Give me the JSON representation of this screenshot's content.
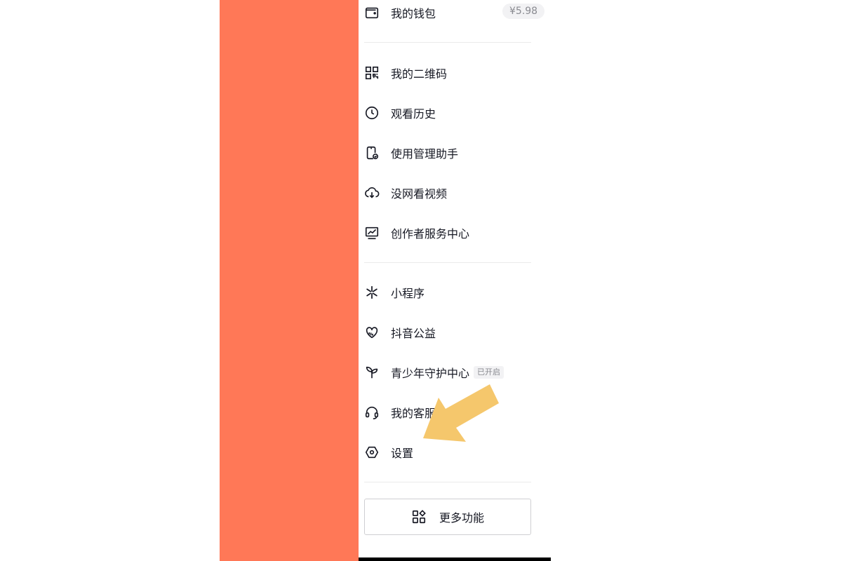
{
  "drawer": {
    "wallet": {
      "label": "我的钱包",
      "badge": "¥5.98",
      "icon": "wallet-icon"
    },
    "group1": [
      {
        "label": "我的二维码",
        "icon": "qr-code-icon"
      },
      {
        "label": "观看历史",
        "icon": "clock-icon"
      },
      {
        "label": "使用管理助手",
        "icon": "phone-check-icon"
      },
      {
        "label": "没网看视频",
        "icon": "cloud-download-icon"
      },
      {
        "label": "创作者服务中心",
        "icon": "chart-monitor-icon"
      }
    ],
    "group2": [
      {
        "label": "小程序",
        "icon": "asterisk-icon"
      },
      {
        "label": "抖音公益",
        "icon": "heart-hand-icon"
      },
      {
        "label": "青少年守护中心",
        "icon": "sprout-icon",
        "tag": "已开启"
      },
      {
        "label": "我的客服",
        "icon": "headset-icon"
      },
      {
        "label": "设置",
        "icon": "settings-hex-icon"
      }
    ],
    "more_button": {
      "label": "更多功能",
      "icon": "apps-grid-icon"
    }
  },
  "colors": {
    "left_panel": "#ff7857",
    "arrow": "#f5c76c",
    "text": "#161823",
    "muted": "#8a8b91"
  }
}
